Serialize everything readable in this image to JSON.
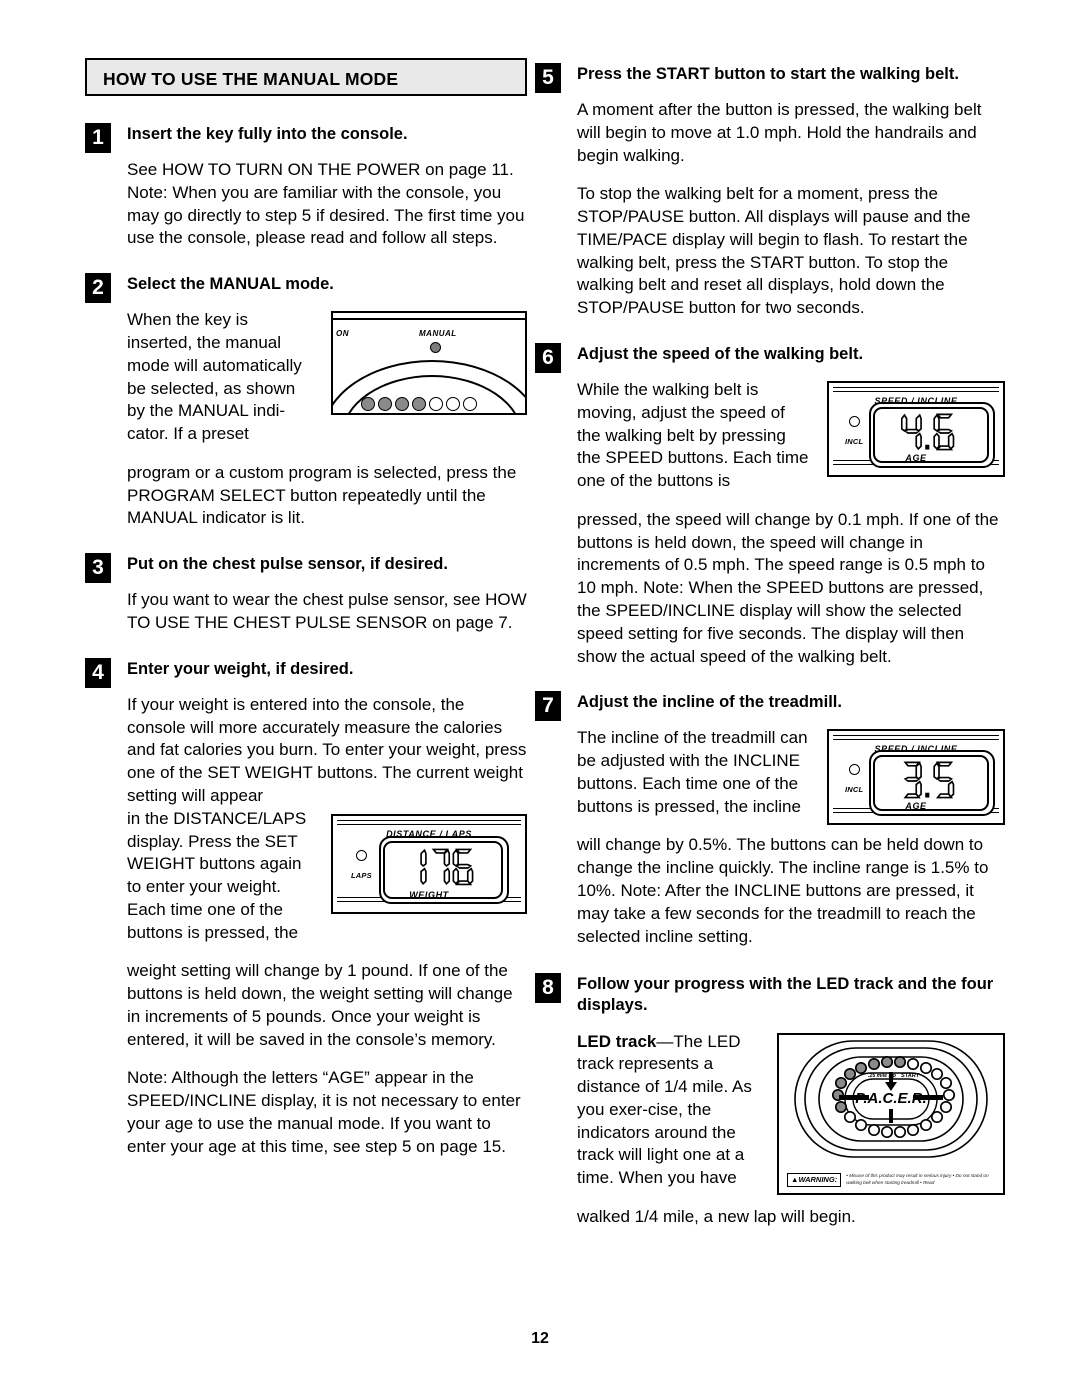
{
  "page": {
    "number": "12",
    "section_title": "HOW TO USE THE MANUAL MODE"
  },
  "steps": [
    {
      "num": "1",
      "title": "Insert the key fully into the console.",
      "paragraphs": [
        "See HOW TO TURN ON THE POWER on page 11. Note: When you are familiar with the console, you may go directly to step 5 if desired. The first time you use the console, please read and follow all steps."
      ]
    },
    {
      "num": "2",
      "title": "Select the MANUAL mode.",
      "wrap_text": "When the key is inserted, the manual mode will automatically be selected, as shown by the MANUAL indi-cator. If a preset",
      "paragraphs": [
        "program or a custom program is selected, press the PROGRAM SELECT button repeatedly until the MANUAL indicator is lit."
      ]
    },
    {
      "num": "3",
      "title": "Put on the chest pulse sensor, if desired.",
      "paragraphs": [
        "If you want to wear the chest pulse sensor, see HOW TO USE THE CHEST PULSE SENSOR on page 7."
      ]
    },
    {
      "num": "4",
      "title": "Enter your weight, if desired.",
      "lead": "If your weight is entered into the console, the console will more accurately measure the calories and fat calories you burn. To enter your weight, press one of the SET WEIGHT buttons. The current weight setting will appear",
      "wrap_text": "in the DISTANCE/LAPS display. Press the SET WEIGHT buttons again to enter your weight. Each time one of the buttons is pressed, the",
      "paragraphs": [
        "weight setting will change by 1 pound. If one of the buttons is held down, the weight setting will change in increments of 5 pounds. Once your weight is entered, it will be saved in the console’s memory.",
        "Note: Although the letters “AGE” appear in the SPEED/INCLINE display, it is not necessary to enter your age to use the manual mode. If you want to enter your age at this time, see step 5 on page 15."
      ]
    },
    {
      "num": "5",
      "title": "Press the START button to start the walking belt.",
      "paragraphs": [
        "A moment after the button is pressed, the walking belt will begin to move at 1.0 mph. Hold the handrails and begin walking.",
        "To stop the walking belt for a moment, press the STOP/PAUSE button. All displays will pause and the TIME/PACE display will begin to flash. To restart the walking belt, press the START button. To stop the walking belt and reset all displays, hold down the STOP/PAUSE button for two seconds."
      ]
    },
    {
      "num": "6",
      "title": "Adjust the speed of the walking belt.",
      "wrap_text": "While the walking belt is moving, adjust the speed of the walking belt by pressing the SPEED buttons. Each time one of the buttons is",
      "paragraphs": [
        "pressed, the speed will change by 0.1 mph. If one of the buttons is held down, the speed will change in increments of 0.5 mph. The speed range is 0.5 mph to 10 mph. Note: When the SPEED buttons are pressed, the SPEED/INCLINE display will show the selected speed setting for five seconds. The display will then show the actual speed of the walking belt."
      ]
    },
    {
      "num": "7",
      "title": "Adjust the incline of the treadmill.",
      "wrap_text": "The incline of the treadmill can be adjusted with the INCLINE buttons. Each time one of the buttons is pressed, the incline",
      "paragraphs": [
        "will change by 0.5%. The buttons can be held down to change the incline quickly. The incline range is 1.5% to 10%. Note: After the INCLINE buttons are pressed, it may take a few seconds for the treadmill to reach the selected incline setting."
      ]
    },
    {
      "num": "8",
      "title": "Follow your progress with the LED track and the four displays.",
      "lead_bold": "LED track",
      "lead_dash": "—The",
      "wrap_text": "LED track represents a distance of 1/4 mile. As you exer-cise, the indicators around the track will light one at a time. When you have",
      "paragraphs": [
        "walked 1/4 mile, a new lap will begin."
      ]
    }
  ],
  "figures": {
    "console": {
      "label_on": "ON",
      "label_manual": "MANUAL",
      "indicator_dots": [
        "lit",
        "lit",
        "lit",
        "lit",
        "off",
        "off",
        "off"
      ]
    },
    "distance_laps_display": {
      "caption": "DISTANCE / LAPS",
      "sub_label": "WEIGHT",
      "indicator_label": "LAPS",
      "value": "176"
    },
    "speed_incline_display_speed": {
      "caption": "SPEED / INCLINE",
      "sub_label": "AGE",
      "indicator_label": "INCL",
      "value": "4.6"
    },
    "speed_incline_display_incline": {
      "caption": "SPEED / INCLINE",
      "sub_label": "AGE",
      "indicator_label": "INCL",
      "value": "3.5"
    },
    "led_track": {
      "brand": "P.A.C.E.R.",
      "lap_label": ".25 mile lap",
      "start_label": "START",
      "warning_badge": "WARNING:",
      "warning_text": "• Misuse of this product may result in serious injury • Do not stand on walking belt when starting treadmill • Read"
    }
  },
  "colors": {
    "header_background": "#e9e9e9",
    "ink": "#000000",
    "lit_indicator": "#8a8a8a",
    "paper": "#ffffff"
  }
}
